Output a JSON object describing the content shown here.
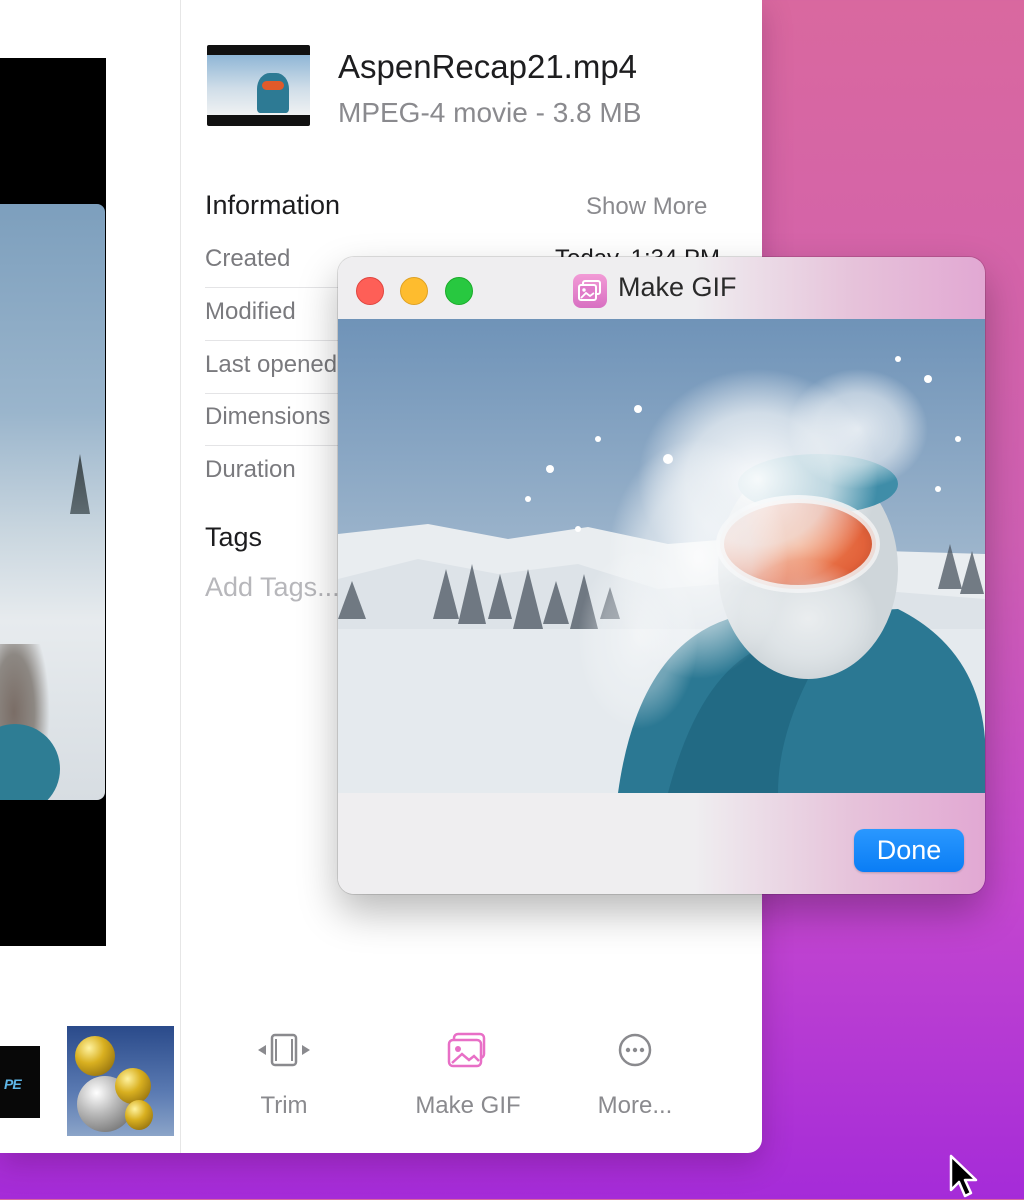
{
  "file": {
    "name": "AspenRecap21.mp4",
    "kind": "MPEG-4 movie - 3.8 MB"
  },
  "information": {
    "title": "Information",
    "show_more": "Show More",
    "rows": [
      {
        "key": "Created",
        "value": "Today, 1:34 PM"
      },
      {
        "key": "Modified",
        "value": ""
      },
      {
        "key": "Last opened",
        "value": ""
      },
      {
        "key": "Dimensions",
        "value": ""
      },
      {
        "key": "Duration",
        "value": ""
      }
    ]
  },
  "tags": {
    "title": "Tags",
    "placeholder": "Add Tags..."
  },
  "toolbar": {
    "trim_label": "Trim",
    "make_gif_label": "Make GIF",
    "more_label": "More..."
  },
  "dialog": {
    "title": "Make GIF",
    "done_label": "Done"
  },
  "thumb_text": "PE",
  "colors": {
    "accent_blue": "#0a7df5",
    "gif_pink": "#e86fc6",
    "traffic_red": "#fe5f57",
    "traffic_yellow": "#febc2e",
    "traffic_green": "#28c840"
  },
  "icons": [
    "trim-icon",
    "make-gif-icon",
    "more-icon",
    "make-gif-app-icon",
    "cursor-arrow-icon"
  ]
}
